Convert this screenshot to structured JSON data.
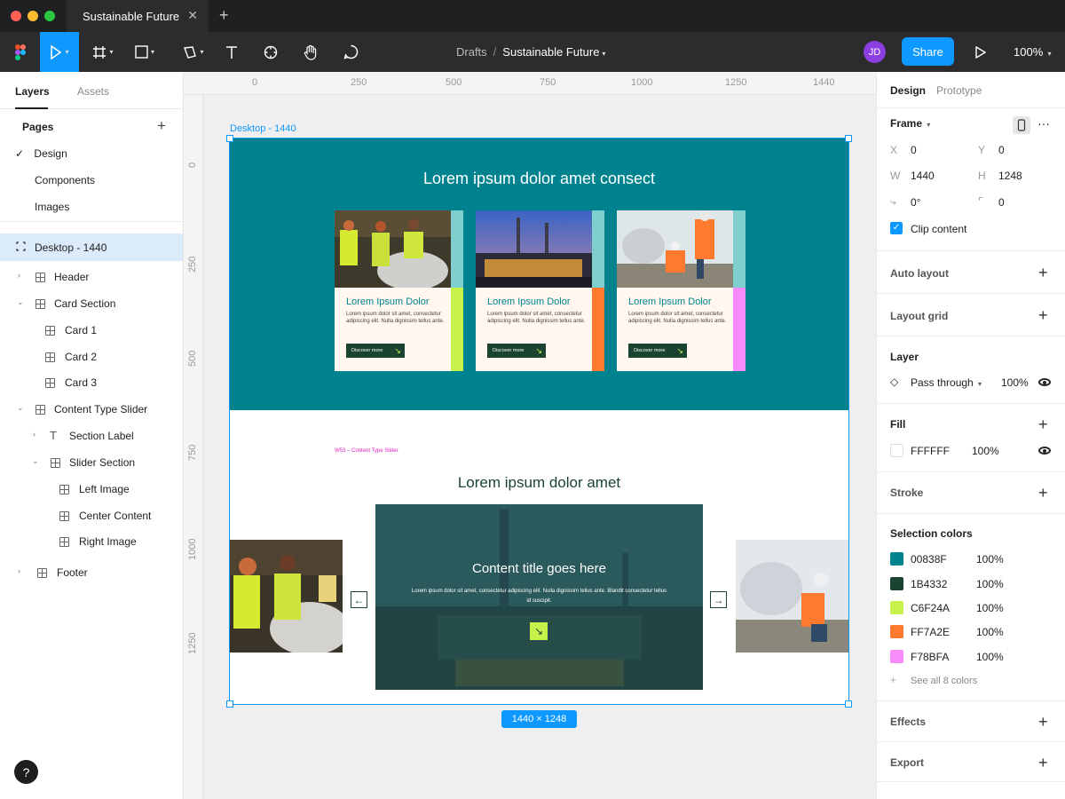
{
  "window": {
    "tab_title": "Sustainable Future",
    "tab_close": "✕",
    "tab_add": "+"
  },
  "toolbar": {
    "breadcrumb_root": "Drafts",
    "breadcrumb_sep": "/",
    "file_name": "Sustainable Future",
    "avatar_initials": "JD",
    "share_label": "Share",
    "zoom": "100%",
    "icons": [
      "figma-menu-icon",
      "move-tool-icon",
      "frame-tool-icon",
      "shape-tool-icon",
      "pen-tool-icon",
      "text-tool-icon",
      "component-tool-icon",
      "hand-tool-icon",
      "comment-tool-icon",
      "present-icon"
    ]
  },
  "left_panel": {
    "tabs": [
      "Layers",
      "Assets"
    ],
    "pages_heading": "Pages",
    "pages": [
      "Design",
      "Components",
      "Images"
    ],
    "layers": [
      "Desktop - 1440",
      "Header",
      "Card Section",
      "Card 1",
      "Card 2",
      "Card 3",
      "Content Type Slider",
      "Section Label",
      "Slider Section",
      "Left Image",
      "Center Content",
      "Right Image",
      "Footer"
    ],
    "help": "?"
  },
  "canvas": {
    "ruler_top": [
      "0",
      "250",
      "500",
      "750",
      "1000",
      "1250",
      "1440"
    ],
    "ruler_left": [
      "0",
      "250",
      "500",
      "750",
      "1000",
      "1250"
    ],
    "frame_label": "Desktop - 1440",
    "frame_size": "1440 × 1248",
    "hero_title": "Lorem ipsum dolor amet consect",
    "cards": [
      {
        "title": "Lorem Ipsum Dolor",
        "body": "Lorem ipsum dolor sit amet, consectetur adipiscing elit. Nulla dignissim tellus ante.",
        "button": "Discover more",
        "accent": "#C6F24A"
      },
      {
        "title": "Lorem Ipsum Dolor",
        "body": "Lorem ipsum dolor sit amet, consectetur adipiscing elit. Nulla dignissim tellus ante.",
        "button": "Discover more",
        "accent": "#FF7A2E"
      },
      {
        "title": "Lorem Ipsum Dolor",
        "body": "Lorem ipsum dolor sit amet, consectetur adipiscing elit. Nulla dignissim tellus ante.",
        "button": "Discover more",
        "accent": "#F78BFA"
      }
    ],
    "section_label": "W53 – Content Type Slider",
    "slider_title": "Lorem ipsum dolor amet",
    "slide_title": "Content title goes here",
    "slide_body": "Lorem ipsum dolor sit amet, consectetur adipiscing elit. Nulla dignissim tellus ante. Blandit consectetur tellus id suscipit.",
    "arrow_glyph": "↘",
    "prev_glyph": "←",
    "next_glyph": "→"
  },
  "right_panel": {
    "tabs": [
      "Design",
      "Prototype"
    ],
    "frame_heading": "Frame",
    "x_label": "X",
    "x_value": "0",
    "y_label": "Y",
    "y_value": "0",
    "w_label": "W",
    "w_value": "1440",
    "h_label": "H",
    "h_value": "1248",
    "rotation_value": "0°",
    "radius_value": "0",
    "clip_content": "Clip content",
    "auto_layout": "Auto layout",
    "layout_grid": "Layout grid",
    "layer_heading": "Layer",
    "blend_mode": "Pass through",
    "layer_opacity": "100%",
    "fill_heading": "Fill",
    "fill_hex": "FFFFFF",
    "fill_opacity": "100%",
    "stroke": "Stroke",
    "selection_colors_heading": "Selection colors",
    "selection_colors": [
      {
        "hex": "00838F",
        "opacity": "100%",
        "color": "#00838F"
      },
      {
        "hex": "1B4332",
        "opacity": "100%",
        "color": "#1B4332"
      },
      {
        "hex": "C6F24A",
        "opacity": "100%",
        "color": "#C6F24A"
      },
      {
        "hex": "FF7A2E",
        "opacity": "100%",
        "color": "#FF7A2E"
      },
      {
        "hex": "F78BFA",
        "opacity": "100%",
        "color": "#F78BFA"
      }
    ],
    "see_all": "See all 8 colors",
    "effects": "Effects",
    "export": "Export"
  }
}
